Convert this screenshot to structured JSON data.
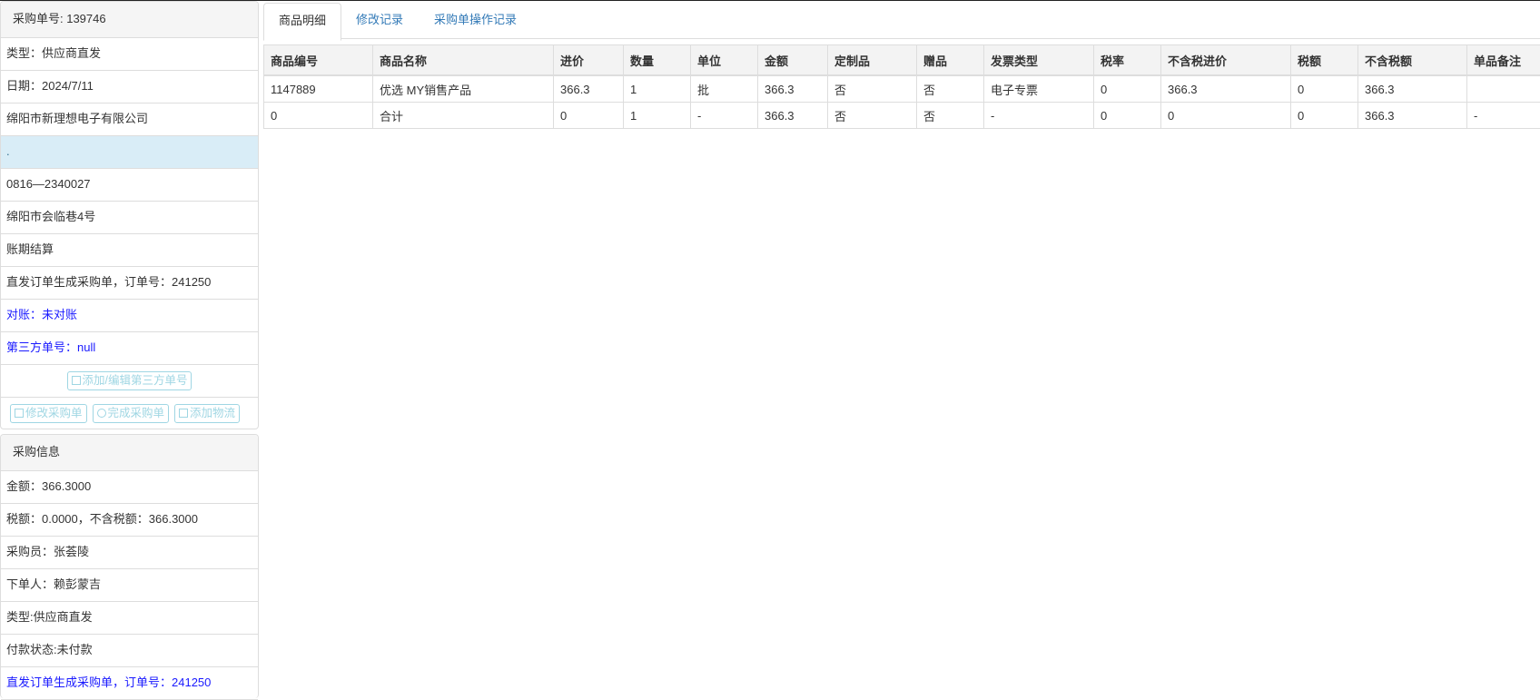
{
  "left": {
    "order_header": "采购单号: 139746",
    "rows": [
      "类型：供应商直发",
      "日期：2024/7/11",
      "绵阳市新理想电子有限公司",
      ".",
      "0816—2340027",
      "绵阳市会临巷4号",
      "账期结算",
      "直发订单生成采购单，订单号：241250",
      "对账：未对账",
      "第三方单号：null"
    ],
    "edit_third_party_label": "添加/编辑第三方单号",
    "modify_order_label": "修改采购单",
    "complete_order_label": "完成采购单",
    "add_logistics_label": "添加物流",
    "info_header": "采购信息",
    "info_rows": [
      "金额：366.3000",
      "税额：0.0000，不含税额：366.3000",
      "采购员：张荟陵",
      "下单人：赖彭蒙吉",
      "类型:供应商直发",
      "付款状态:未付款",
      "直发订单生成采购单，订单号：241250"
    ]
  },
  "tabs": [
    "商品明细",
    "修改记录",
    "采购单操作记录"
  ],
  "table": {
    "headers": [
      "商品编号",
      "商品名称",
      "进价",
      "数量",
      "单位",
      "金额",
      "定制品",
      "赠品",
      "发票类型",
      "税率",
      "不含税进价",
      "税额",
      "不含税额",
      "单品备注"
    ],
    "rows": [
      [
        "1147889",
        "优选 MY销售产品",
        "366.3",
        "1",
        "批",
        "366.3",
        "否",
        "否",
        "电子专票",
        "0",
        "366.3",
        "0",
        "366.3",
        ""
      ],
      [
        "0",
        "合计",
        "0",
        "1",
        "-",
        "366.3",
        "否",
        "否",
        "-",
        "0",
        "0",
        "0",
        "366.3",
        "-"
      ]
    ]
  },
  "colors": {
    "link": "#337ab7",
    "blue_text": "#1a1aff",
    "highlight_row": "#d9edf7",
    "button_border": "#9fd6e3"
  }
}
